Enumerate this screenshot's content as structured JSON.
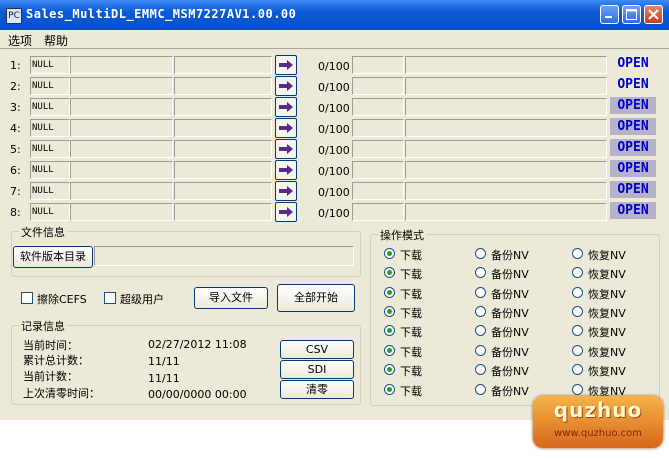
{
  "window": {
    "title": "Sales_MultiDL_EMMC_MSM7227AV1.00.00",
    "icon_glyph": "PC"
  },
  "menu": [
    "选项",
    "帮助"
  ],
  "ports": [
    {
      "num": "1:",
      "name": "NULL",
      "progress": "0/100",
      "status": "OPEN"
    },
    {
      "num": "2:",
      "name": "NULL",
      "progress": "0/100",
      "status": "OPEN"
    },
    {
      "num": "3:",
      "name": "NULL",
      "progress": "0/100",
      "status": "OPEN"
    },
    {
      "num": "4:",
      "name": "NULL",
      "progress": "0/100",
      "status": "OPEN"
    },
    {
      "num": "5:",
      "name": "NULL",
      "progress": "0/100",
      "status": "OPEN"
    },
    {
      "num": "6:",
      "name": "NULL",
      "progress": "0/100",
      "status": "OPEN"
    },
    {
      "num": "7:",
      "name": "NULL",
      "progress": "0/100",
      "status": "OPEN"
    },
    {
      "num": "8:",
      "name": "NULL",
      "progress": "0/100",
      "status": "OPEN"
    }
  ],
  "file_info": {
    "title": "文件信息",
    "version_dir_button": "软件版本目录",
    "path": ""
  },
  "controls": {
    "erase_cefs": "擦除CEFS",
    "super_user": "超级用户",
    "import_file": "导入文件",
    "start_all": "全部开始"
  },
  "log_info": {
    "title": "记录信息",
    "rows": [
      {
        "label": "当前时间：",
        "value": "02/27/2012 11:08"
      },
      {
        "label": "累计总计数：",
        "value": "11/11"
      },
      {
        "label": "当前计数：",
        "value": "11/11"
      },
      {
        "label": "上次清零时间：",
        "value": "00/00/0000 00:00"
      }
    ],
    "buttons": [
      "CSV",
      "SDI",
      "清零"
    ]
  },
  "mode": {
    "title": "操作模式",
    "options": [
      "下载",
      "备份NV",
      "恢复NV"
    ],
    "selected": "下载"
  },
  "watermark": {
    "logo": "quzhuo",
    "url": "www.quzhuo.com"
  },
  "colors": {
    "open_text": "#0000c8",
    "open_highlight": "#b5b2c9",
    "title_bar": "#0a5ad7"
  }
}
